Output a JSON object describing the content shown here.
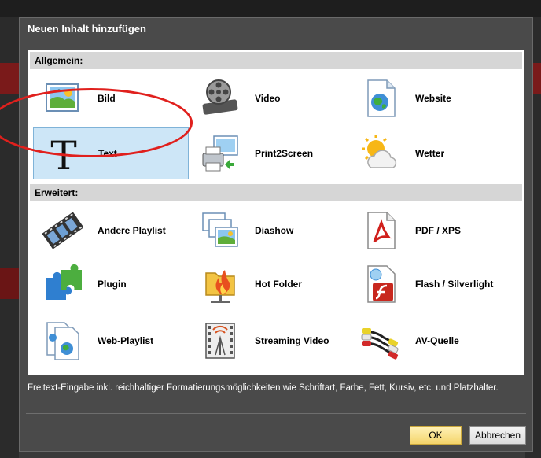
{
  "dialog": {
    "title": "Neuen Inhalt hinzufügen",
    "description": "Freitext-Eingabe inkl. reichhaltiger Formatierungsmöglichkeiten wie Schriftart, Farbe, Fett, Kursiv, etc. und Platzhalter.",
    "ok_label": "OK",
    "cancel_label": "Abbrechen"
  },
  "sections": [
    {
      "label": "Allgemein:",
      "items": [
        {
          "label": "Bild",
          "icon": "picture-icon"
        },
        {
          "label": "Video",
          "icon": "film-reel-icon"
        },
        {
          "label": "Website",
          "icon": "globe-document-icon"
        },
        {
          "label": "Text",
          "icon": "text-T-icon",
          "selected": true
        },
        {
          "label": "Print2Screen",
          "icon": "printer-icon"
        },
        {
          "label": "Wetter",
          "icon": "sun-cloud-icon"
        }
      ]
    },
    {
      "label": "Erweitert:",
      "items": [
        {
          "label": "Andere Playlist",
          "icon": "filmstrip-icon"
        },
        {
          "label": "Diashow",
          "icon": "slideshow-icon"
        },
        {
          "label": "PDF / XPS",
          "icon": "pdf-icon"
        },
        {
          "label": "Plugin",
          "icon": "puzzle-icon"
        },
        {
          "label": "Hot Folder",
          "icon": "hot-folder-icon"
        },
        {
          "label": "Flash / Silverlight",
          "icon": "flash-icon"
        },
        {
          "label": "Web-Playlist",
          "icon": "web-playlist-icon"
        },
        {
          "label": "Streaming Video",
          "icon": "streaming-video-icon"
        },
        {
          "label": "AV-Quelle",
          "icon": "av-cable-icon"
        }
      ]
    }
  ],
  "colors": {
    "selection": "#cde6f7",
    "annotation": "#e0201d",
    "ok_button": "#f4d46a"
  }
}
